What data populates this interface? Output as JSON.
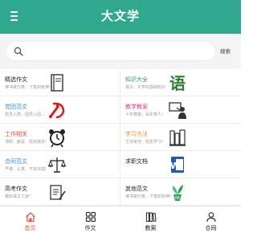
{
  "header": {
    "title": "大文学"
  },
  "search": {
    "placeholder": "",
    "button_label": "搜索"
  },
  "colors": {
    "brand": "#2fa88e",
    "title_blue": "#3b8fd9",
    "title_red": "#e04a3f",
    "title_orange": "#f08c2e",
    "title_green": "#2e9f5e",
    "title_pink": "#d9418a",
    "tab_active": "#e8553e"
  },
  "categories": [
    {
      "title": "精选作文",
      "desc": "读书做万卷，下笔如有神!",
      "icon": "book-icon"
    },
    {
      "title": "知识大全",
      "desc": "语文、文学的基础知识",
      "icon": "yu-character-icon"
    },
    {
      "title": "党团范文",
      "desc": "党员入党，团员入团...",
      "icon": "party-emblem-icon"
    },
    {
      "title": "教学教案",
      "desc": "十年寒窗，百年育人!",
      "icon": "teacher-icon"
    },
    {
      "title": "工作相关",
      "desc": "求职、面试、轻松搞定!",
      "icon": "alarm-clock-icon"
    },
    {
      "title": "学习方法",
      "desc": "方法得当，轻松学习!",
      "icon": "books-icon"
    },
    {
      "title": "合同范文",
      "desc": "严谨、认真、不容出错!",
      "icon": "scales-icon"
    },
    {
      "title": "求职文档",
      "desc": "",
      "icon": "word-document-icon"
    },
    {
      "title": "高考作文",
      "desc": "模拟语文之家!",
      "icon": "exam-icon"
    },
    {
      "title": "其他范文",
      "desc": "读书做万卷，下笔如有神!",
      "icon": "plant-icon"
    }
  ],
  "tabs": [
    {
      "label": "首页",
      "icon": "home-icon",
      "active": true
    },
    {
      "label": "作文",
      "icon": "grid-icon",
      "active": false
    },
    {
      "label": "教案",
      "icon": "books-icon",
      "active": false
    },
    {
      "label": "合同",
      "icon": "user-icon",
      "active": false
    }
  ]
}
